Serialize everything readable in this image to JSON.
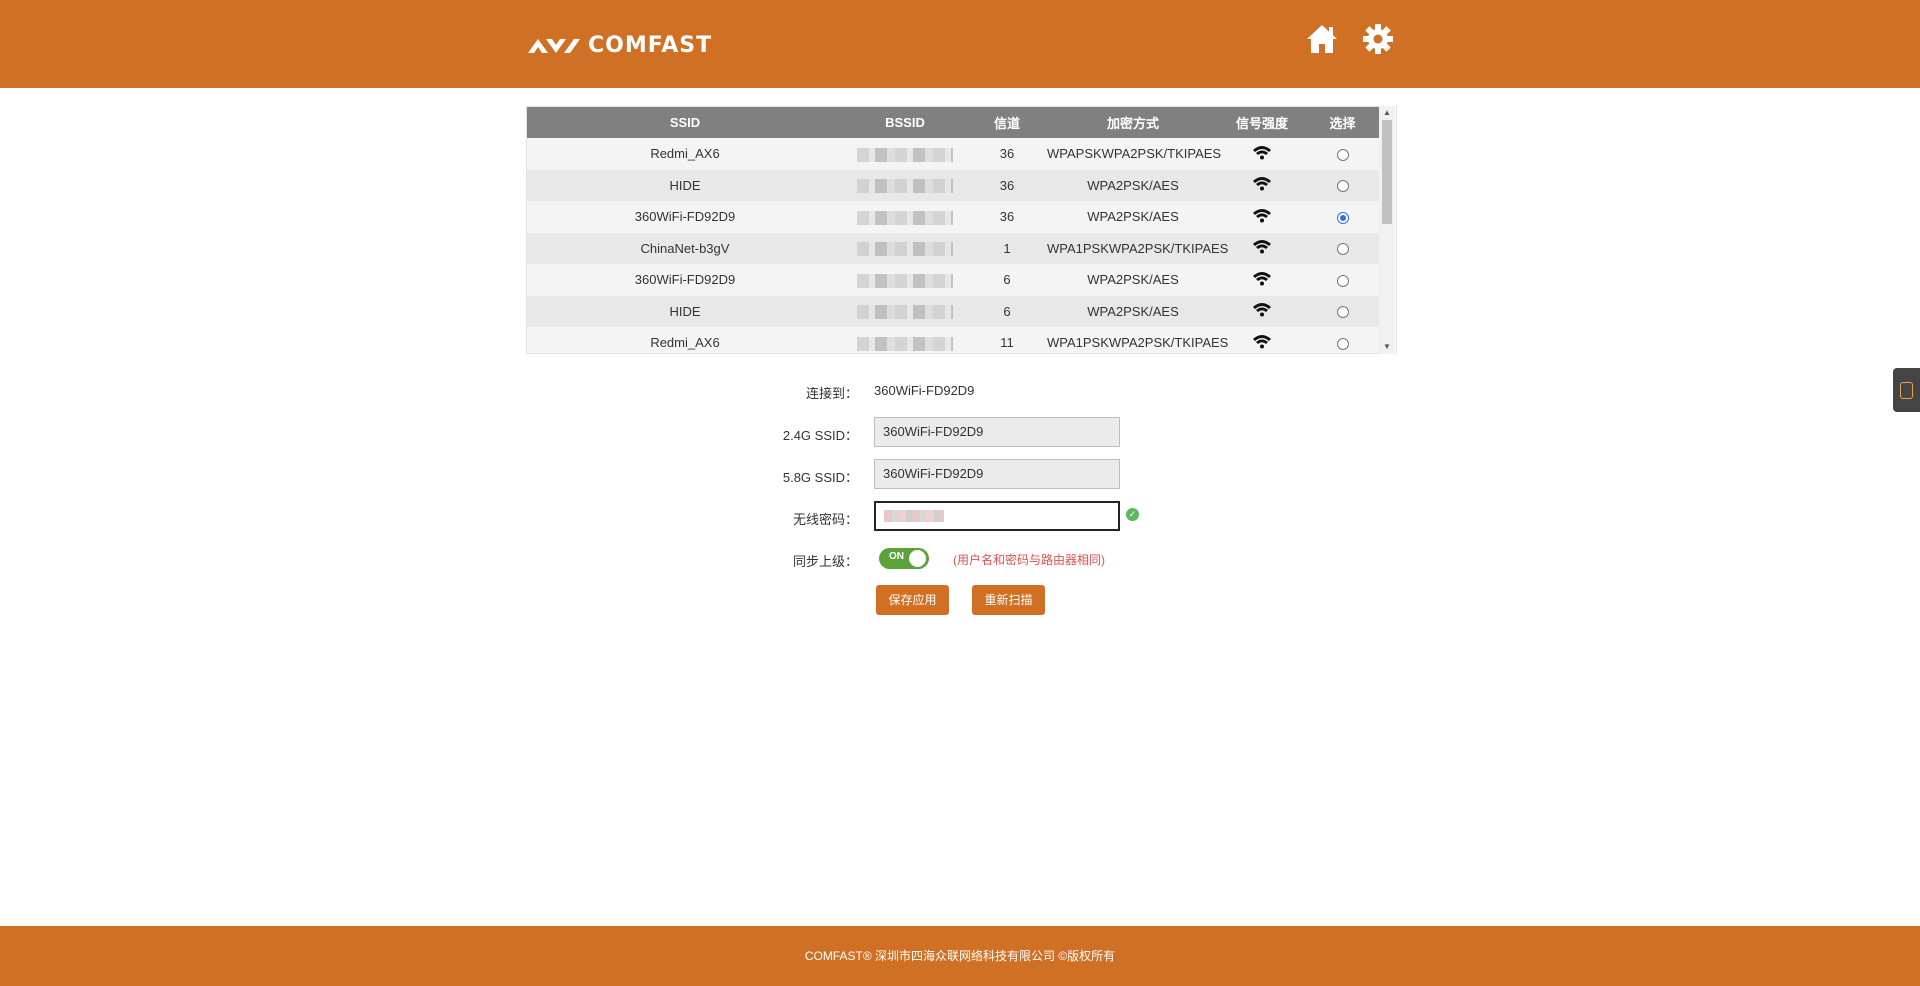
{
  "header": {
    "logo_text": "COMFAST",
    "home_icon": "home-icon",
    "settings_icon": "gear-icon",
    "brand_color": "#d07025"
  },
  "scan_table": {
    "columns": [
      "SSID",
      "BSSID",
      "信道",
      "加密方式",
      "信号强度",
      "选择"
    ],
    "rows": [
      {
        "ssid": "Redmi_AX6",
        "channel": "36",
        "encryption": "WPAPSKWPA2PSK/TKIPAES",
        "selected": false
      },
      {
        "ssid": "HIDE",
        "channel": "36",
        "encryption": "WPA2PSK/AES",
        "selected": false
      },
      {
        "ssid": "360WiFi-FD92D9",
        "channel": "36",
        "encryption": "WPA2PSK/AES",
        "selected": true
      },
      {
        "ssid": "ChinaNet-b3gV",
        "channel": "1",
        "encryption": "WPA1PSKWPA2PSK/TKIPAES",
        "selected": false
      },
      {
        "ssid": "360WiFi-FD92D9",
        "channel": "6",
        "encryption": "WPA2PSK/AES",
        "selected": false
      },
      {
        "ssid": "HIDE",
        "channel": "6",
        "encryption": "WPA2PSK/AES",
        "selected": false
      },
      {
        "ssid": "Redmi_AX6",
        "channel": "11",
        "encryption": "WPA1PSKWPA2PSK/TKIPAES",
        "selected": false
      }
    ]
  },
  "form": {
    "connect_label": "连接到：",
    "connect_value": "360WiFi-FD92D9",
    "ssid24_label": "2.4G SSID：",
    "ssid24_value": "360WiFi-FD92D9",
    "ssid58_label": "5.8G SSID：",
    "ssid58_value": "360WiFi-FD92D9",
    "password_label": "无线密码：",
    "sync_label": "同步上级：",
    "sync_toggle": "ON",
    "sync_note": "(用户名和密码与路由器相同)",
    "save_button": "保存应用",
    "rescan_button": "重新扫描"
  },
  "footer": {
    "text": "COMFAST® 深圳市四海众联网络科技有限公司 ©版权所有"
  }
}
